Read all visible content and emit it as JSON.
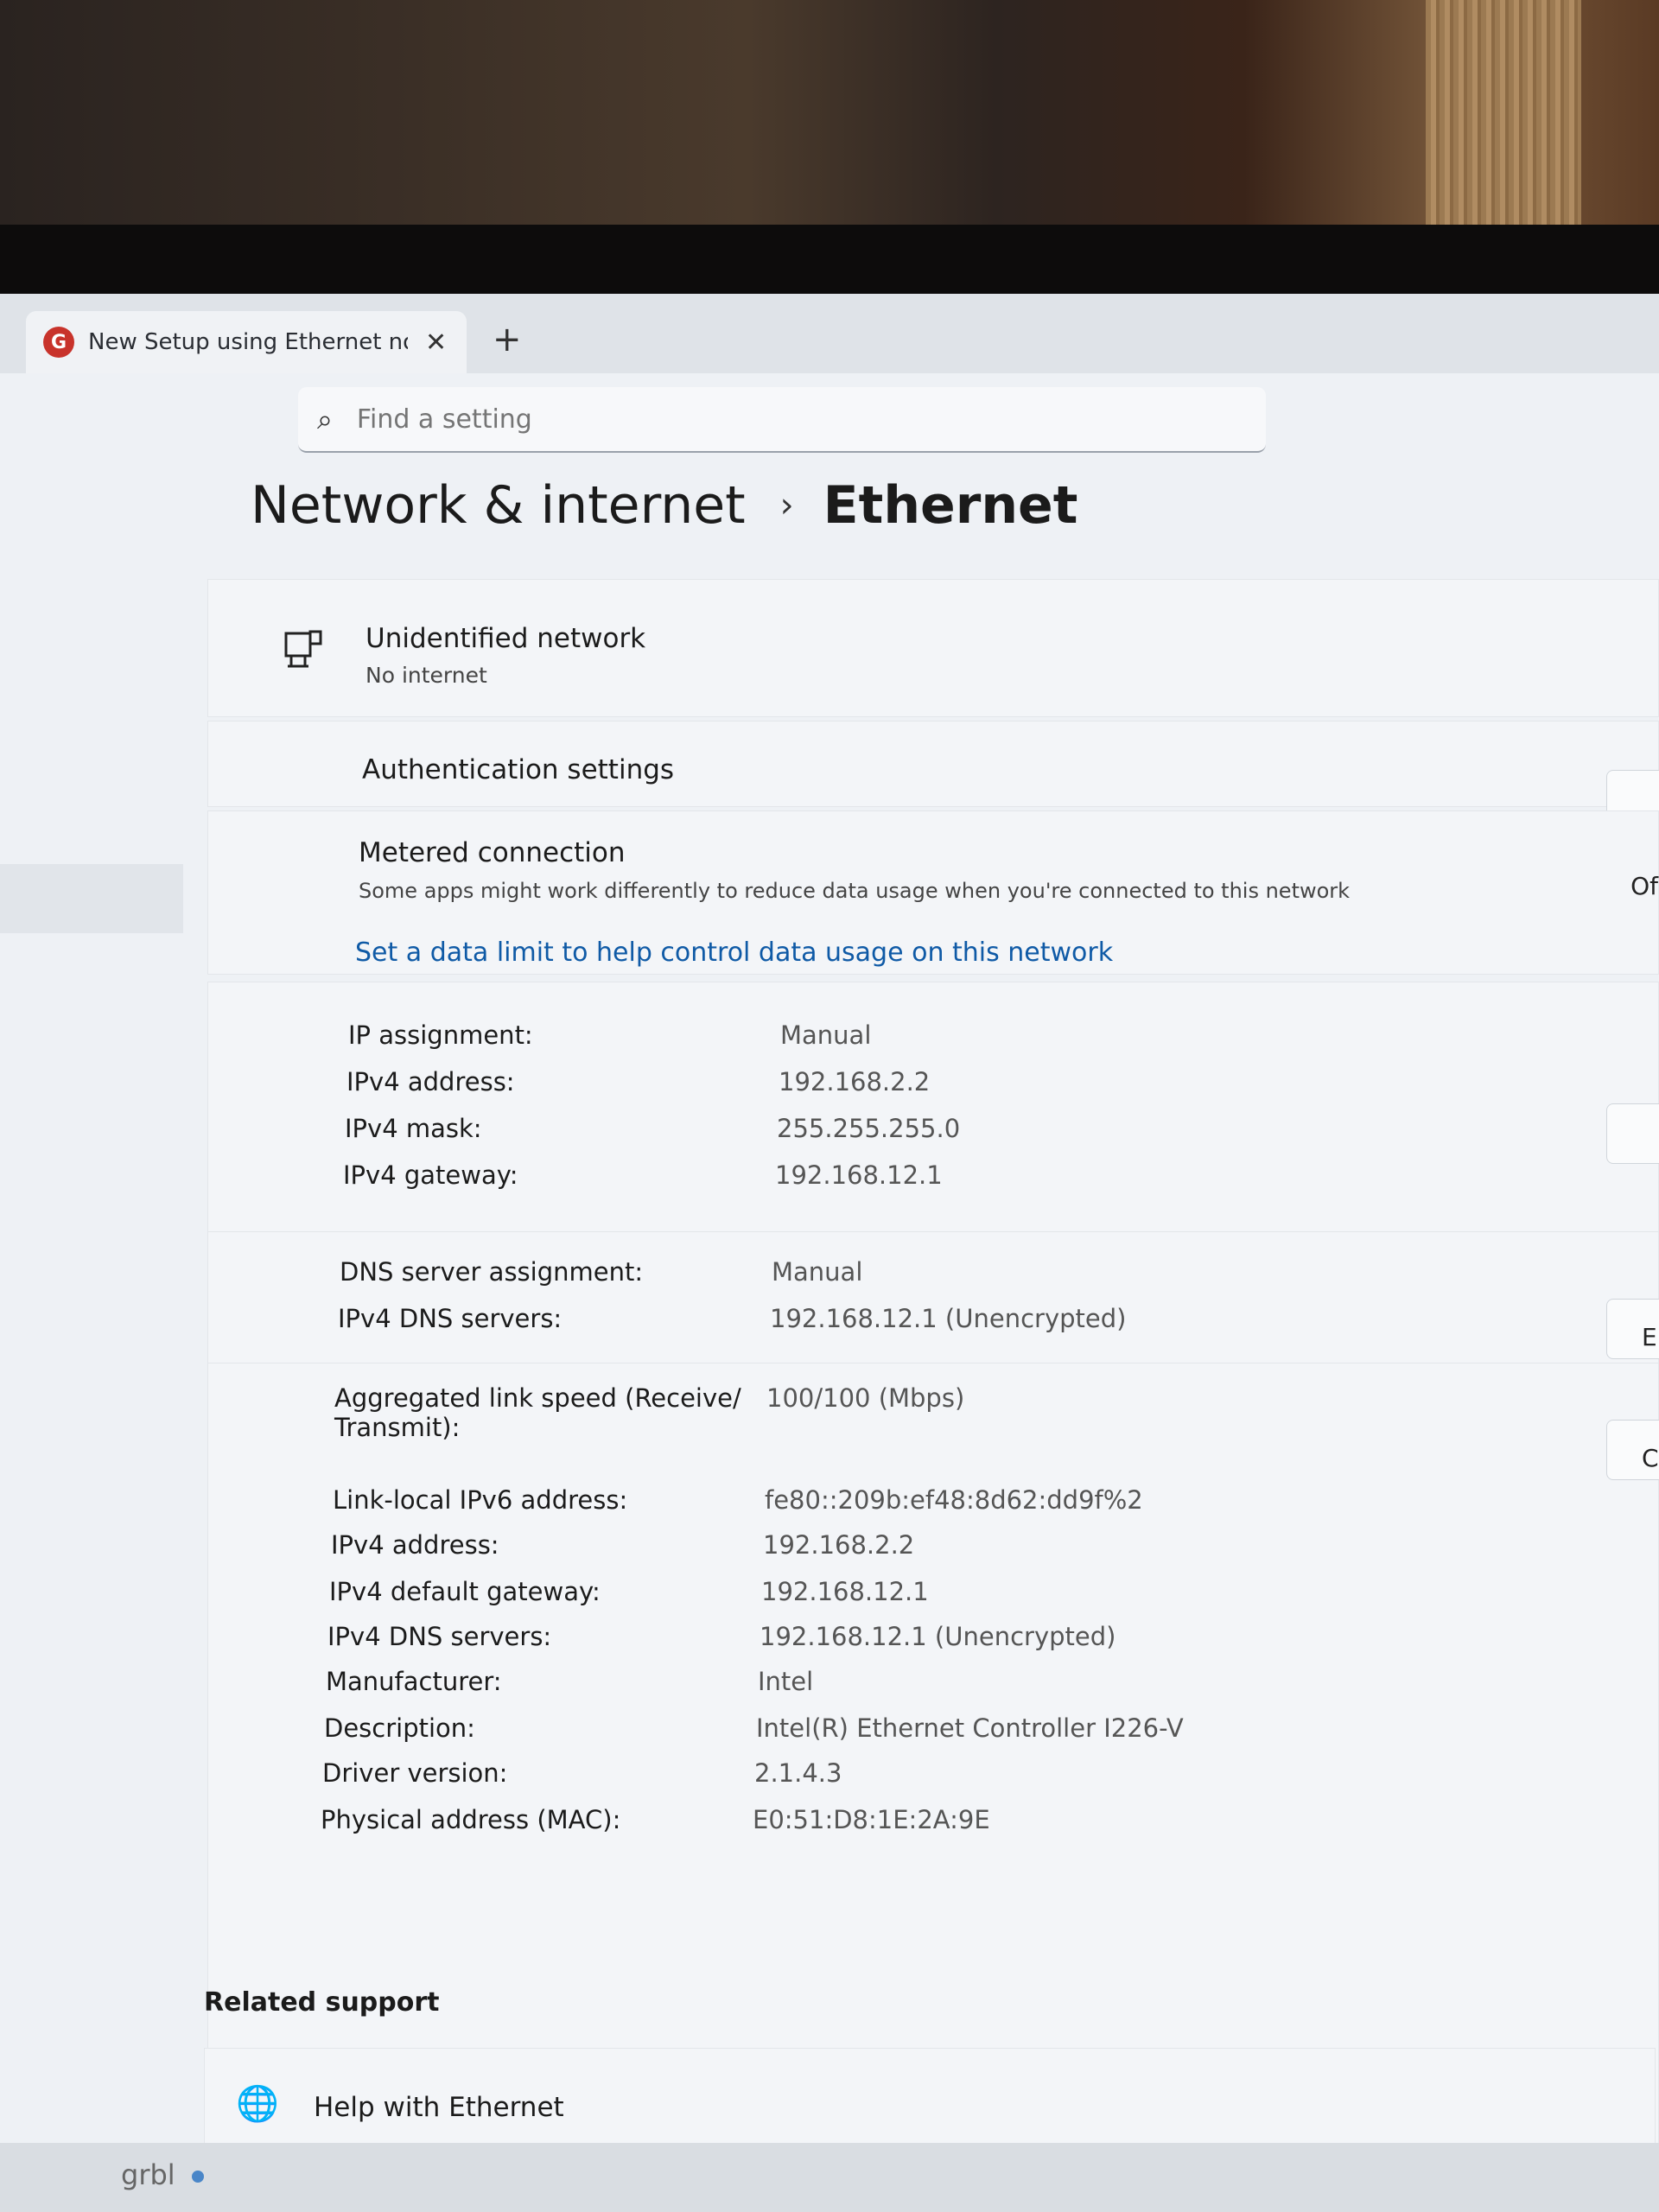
{
  "browser": {
    "tab_title": "New Setup using Ethernet not c",
    "tab_close": "✕",
    "new_tab": "+"
  },
  "search": {
    "placeholder": "Find a setting"
  },
  "breadcrumb": {
    "parent": "Network & internet",
    "separator": "›",
    "current": "Ethernet"
  },
  "network": {
    "name": "Unidentified network",
    "status": "No internet"
  },
  "authentication": {
    "label": "Authentication settings"
  },
  "metered": {
    "title": "Metered connection",
    "description": "Some apps might work differently to reduce data usage when you're connected to this network",
    "toggle_state": "Of",
    "data_limit_link": "Set a data limit to help control data usage on this network"
  },
  "ip_settings": {
    "ip_assignment_label": "IP assignment:",
    "ip_assignment_value": "Manual",
    "ipv4_address_label": "IPv4 address:",
    "ipv4_address_value": "192.168.2.2",
    "ipv4_mask_label": "IPv4 mask:",
    "ipv4_mask_value": "255.255.255.0",
    "ipv4_gateway_label": "IPv4 gateway:",
    "ipv4_gateway_value": "192.168.12.1",
    "edit_button": ""
  },
  "dns_settings": {
    "assignment_label": "DNS server assignment:",
    "assignment_value": "Manual",
    "servers_label": "IPv4 DNS servers:",
    "servers_value": "192.168.12.1 (Unencrypted)",
    "edit_button": "E"
  },
  "properties": {
    "copy_button": "C",
    "rows": [
      {
        "label": "Aggregated link speed (Receive/ Transmit):",
        "value": "100/100 (Mbps)"
      },
      {
        "label": "Link-local IPv6 address:",
        "value": "fe80::209b:ef48:8d62:dd9f%2"
      },
      {
        "label": "IPv4 address:",
        "value": "192.168.2.2"
      },
      {
        "label": "IPv4 default gateway:",
        "value": "192.168.12.1"
      },
      {
        "label": "IPv4 DNS servers:",
        "value": "192.168.12.1 (Unencrypted)"
      },
      {
        "label": "Manufacturer:",
        "value": "Intel"
      },
      {
        "label": "Description:",
        "value": "Intel(R) Ethernet Controller I226-V"
      },
      {
        "label": "Driver version:",
        "value": "2.1.4.3"
      },
      {
        "label": "Physical address (MAC):",
        "value": "E0:51:D8:1E:2A:9E"
      }
    ]
  },
  "related_support": {
    "title": "Related support",
    "help_label": "Help with Ethernet"
  },
  "taskbar": {
    "label": "grbl"
  }
}
